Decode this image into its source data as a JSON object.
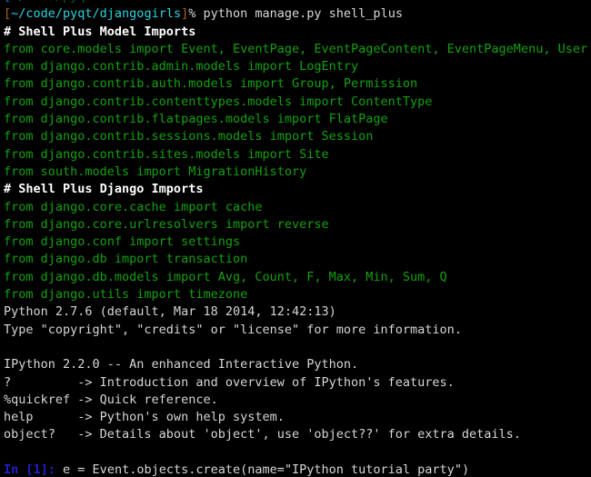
{
  "terminal": {
    "window_title": "python manage.py shell_plus",
    "background_color": "#000000",
    "colors": {
      "white": "#d6d6d6",
      "bright_white": "#ffffff",
      "green": "#13a10e",
      "cyan": "#29d3e0",
      "blue": "#2020cc",
      "orange": "#b06010"
    },
    "clipped_top_line": {
      "segments": [
        {
          "text": "[~/",
          "color": "cyan"
        },
        {
          "text": "code",
          "color": "cyan"
        }
      ],
      "note": "previous prompt line scrolled off, only bottom pixels visible"
    },
    "prompt": {
      "bracket_open": "[",
      "path": "~/code/pyqt/djangogirls",
      "bracket_close": "]",
      "symbol": "%",
      "command": "python manage.py shell_plus"
    },
    "ipython_prompt": {
      "label": "In [1]:",
      "input": "e = Event.objects.create(name=\"IPython tutorial party\")"
    },
    "lines": [
      {
        "id": "line-prompt",
        "type": "prompt"
      },
      {
        "id": "line-header-models",
        "type": "text",
        "color": "bwhite",
        "text": "# Shell Plus Model Imports"
      },
      {
        "id": "line-import-01",
        "type": "text",
        "color": "green",
        "text": "from core.models import Event, EventPage, EventPageContent, EventPageMenu, User"
      },
      {
        "id": "line-import-02",
        "type": "text",
        "color": "green",
        "text": "from django.contrib.admin.models import LogEntry"
      },
      {
        "id": "line-import-03",
        "type": "text",
        "color": "green",
        "text": "from django.contrib.auth.models import Group, Permission"
      },
      {
        "id": "line-import-04",
        "type": "text",
        "color": "green",
        "text": "from django.contrib.contenttypes.models import ContentType"
      },
      {
        "id": "line-import-05",
        "type": "text",
        "color": "green",
        "text": "from django.contrib.flatpages.models import FlatPage"
      },
      {
        "id": "line-import-06",
        "type": "text",
        "color": "green",
        "text": "from django.contrib.sessions.models import Session"
      },
      {
        "id": "line-import-07",
        "type": "text",
        "color": "green",
        "text": "from django.contrib.sites.models import Site"
      },
      {
        "id": "line-import-08",
        "type": "text",
        "color": "green",
        "text": "from south.models import MigrationHistory"
      },
      {
        "id": "line-header-django",
        "type": "text",
        "color": "bwhite",
        "text": "# Shell Plus Django Imports"
      },
      {
        "id": "line-import-09",
        "type": "text",
        "color": "green",
        "text": "from django.core.cache import cache"
      },
      {
        "id": "line-import-10",
        "type": "text",
        "color": "green",
        "text": "from django.core.urlresolvers import reverse"
      },
      {
        "id": "line-import-11",
        "type": "text",
        "color": "green",
        "text": "from django.conf import settings"
      },
      {
        "id": "line-import-12",
        "type": "text",
        "color": "green",
        "text": "from django.db import transaction"
      },
      {
        "id": "line-import-13",
        "type": "text",
        "color": "green",
        "text": "from django.db.models import Avg, Count, F, Max, Min, Sum, Q"
      },
      {
        "id": "line-import-14",
        "type": "text",
        "color": "green",
        "text": "from django.utils import timezone"
      },
      {
        "id": "line-python-version",
        "type": "text",
        "color": "white",
        "text": "Python 2.7.6 (default, Mar 18 2014, 12:42:13)"
      },
      {
        "id": "line-python-type",
        "type": "text",
        "color": "white",
        "text": "Type \"copyright\", \"credits\" or \"license\" for more information."
      },
      {
        "id": "line-blank-1",
        "type": "blank",
        "text": ""
      },
      {
        "id": "line-ipython-banner",
        "type": "text",
        "color": "white",
        "text": "IPython 2.2.0 -- An enhanced Interactive Python."
      },
      {
        "id": "line-help-question",
        "type": "text",
        "color": "white",
        "text": "?         -> Introduction and overview of IPython's features."
      },
      {
        "id": "line-help-quickref",
        "type": "text",
        "color": "white",
        "text": "%quickref -> Quick reference."
      },
      {
        "id": "line-help-help",
        "type": "text",
        "color": "white",
        "text": "help      -> Python's own help system."
      },
      {
        "id": "line-help-object",
        "type": "text",
        "color": "white",
        "text": "object?   -> Details about 'object', use 'object??' for extra details."
      },
      {
        "id": "line-blank-2",
        "type": "blank",
        "text": ""
      },
      {
        "id": "line-ipython-input",
        "type": "ipython"
      }
    ]
  }
}
